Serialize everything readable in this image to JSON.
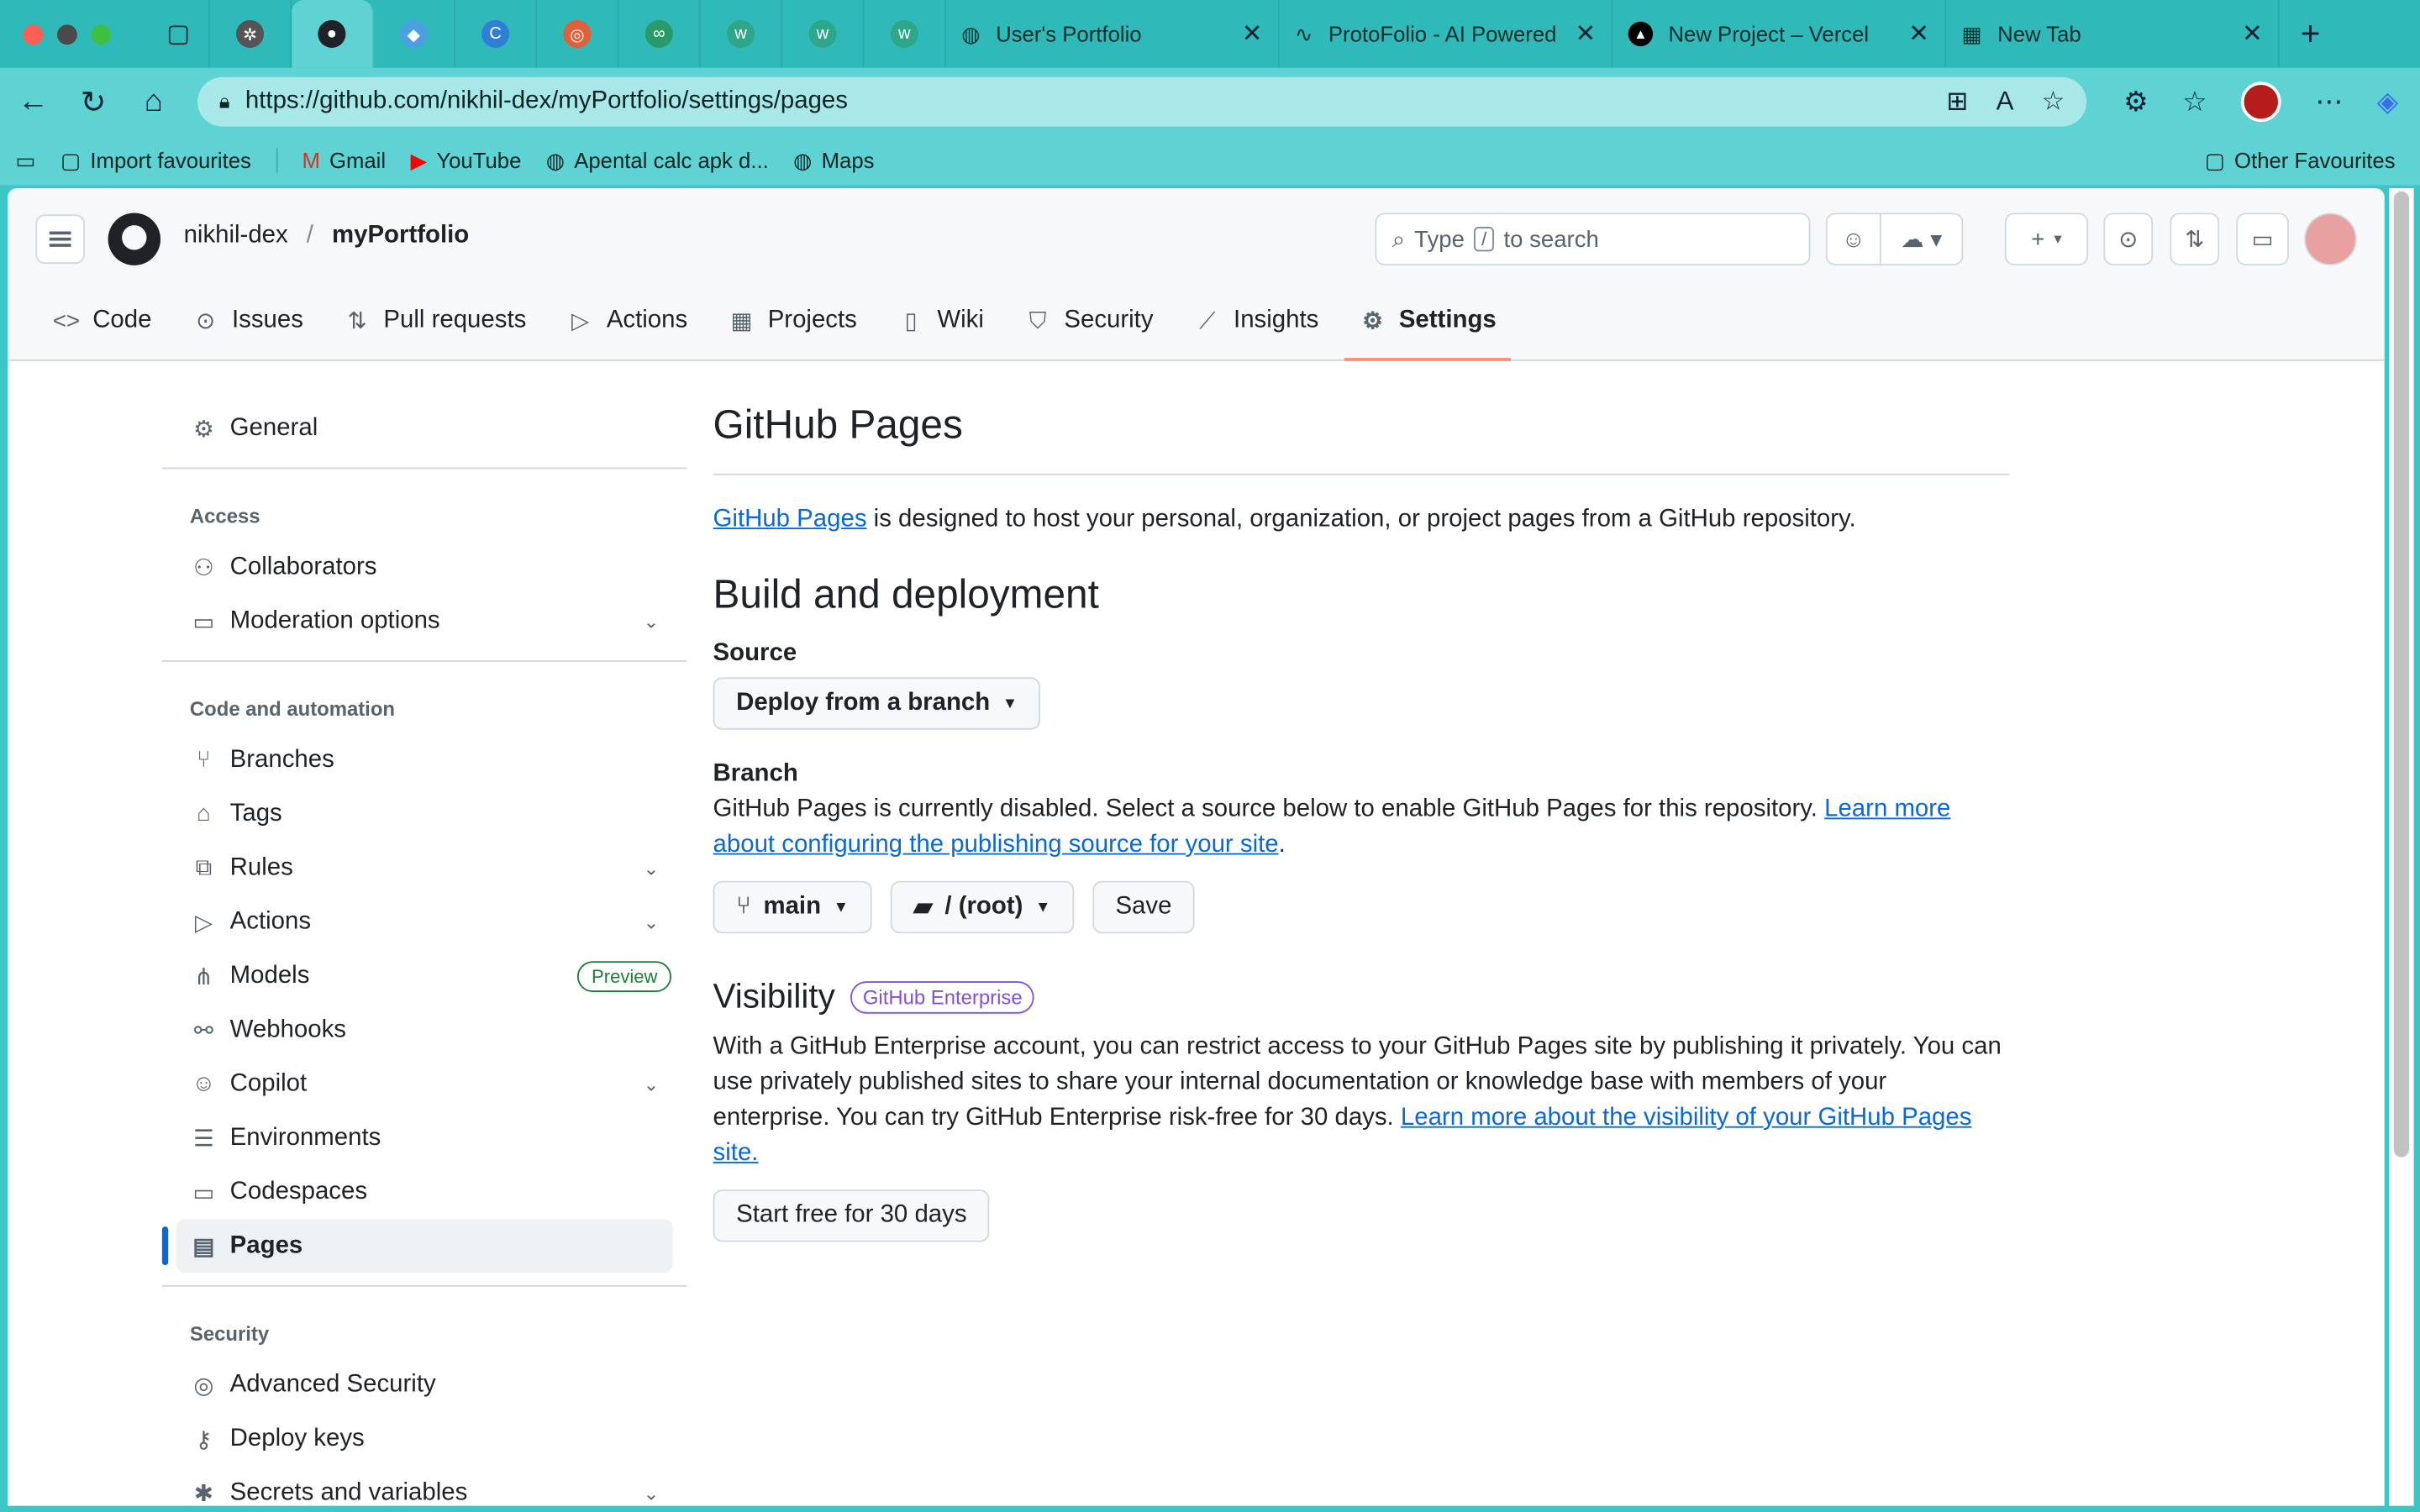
{
  "browser": {
    "tabs": [
      {
        "title": "User's Portfolio"
      },
      {
        "title": "ProtoFolio - AI Powered"
      },
      {
        "title": "New Project – Vercel"
      },
      {
        "title": "New Tab"
      }
    ],
    "url": "https://github.com/nikhil-dex/myPortfolio/settings/pages",
    "favourites": [
      "Import favourites",
      "Gmail",
      "YouTube",
      "Apental calc apk d...",
      "Maps"
    ],
    "other_favourites": "Other Favourites"
  },
  "header": {
    "owner": "nikhil-dex",
    "separator": "/",
    "repo": "myPortfolio",
    "search_prefix": "Type",
    "search_key": "/",
    "search_suffix": "to search",
    "add_plus": "+"
  },
  "repo_nav": [
    {
      "label": "Code",
      "icon": "code-icon"
    },
    {
      "label": "Issues",
      "icon": "issue-icon"
    },
    {
      "label": "Pull requests",
      "icon": "pull-request-icon"
    },
    {
      "label": "Actions",
      "icon": "play-icon"
    },
    {
      "label": "Projects",
      "icon": "table-icon"
    },
    {
      "label": "Wiki",
      "icon": "book-icon"
    },
    {
      "label": "Security",
      "icon": "shield-icon"
    },
    {
      "label": "Insights",
      "icon": "graph-icon"
    },
    {
      "label": "Settings",
      "icon": "gear-icon"
    }
  ],
  "sidebar": {
    "general": "General",
    "access_heading": "Access",
    "access": [
      "Collaborators",
      "Moderation options"
    ],
    "code_heading": "Code and automation",
    "code": [
      "Branches",
      "Tags",
      "Rules",
      "Actions",
      "Models",
      "Webhooks",
      "Copilot",
      "Environments",
      "Codespaces",
      "Pages"
    ],
    "models_badge": "Preview",
    "security_heading": "Security",
    "security": [
      "Advanced Security",
      "Deploy keys",
      "Secrets and variables"
    ]
  },
  "main": {
    "title": "GitHub Pages",
    "intro_link": "GitHub Pages",
    "intro_text": " is designed to host your personal, organization, or project pages from a GitHub repository.",
    "build_title": "Build and deployment",
    "source_label": "Source",
    "source_value": "Deploy from a branch",
    "branch_label": "Branch",
    "branch_text": "GitHub Pages is currently disabled. Select a source below to enable GitHub Pages for this repository. ",
    "branch_link": "Learn more about configuring the publishing source for your site",
    "branch_value": "main",
    "folder_value": "/ (root)",
    "save_label": "Save",
    "visibility_title": "Visibility",
    "enterprise_badge": "GitHub Enterprise",
    "visibility_text": "With a GitHub Enterprise account, you can restrict access to your GitHub Pages site by publishing it privately. You can use privately published sites to share your internal documentation or knowledge base with members of your enterprise. You can try GitHub Enterprise risk-free for 30 days. ",
    "visibility_link": "Learn more about the visibility of your GitHub Pages site.",
    "trial_button": "Start free for 30 days"
  }
}
